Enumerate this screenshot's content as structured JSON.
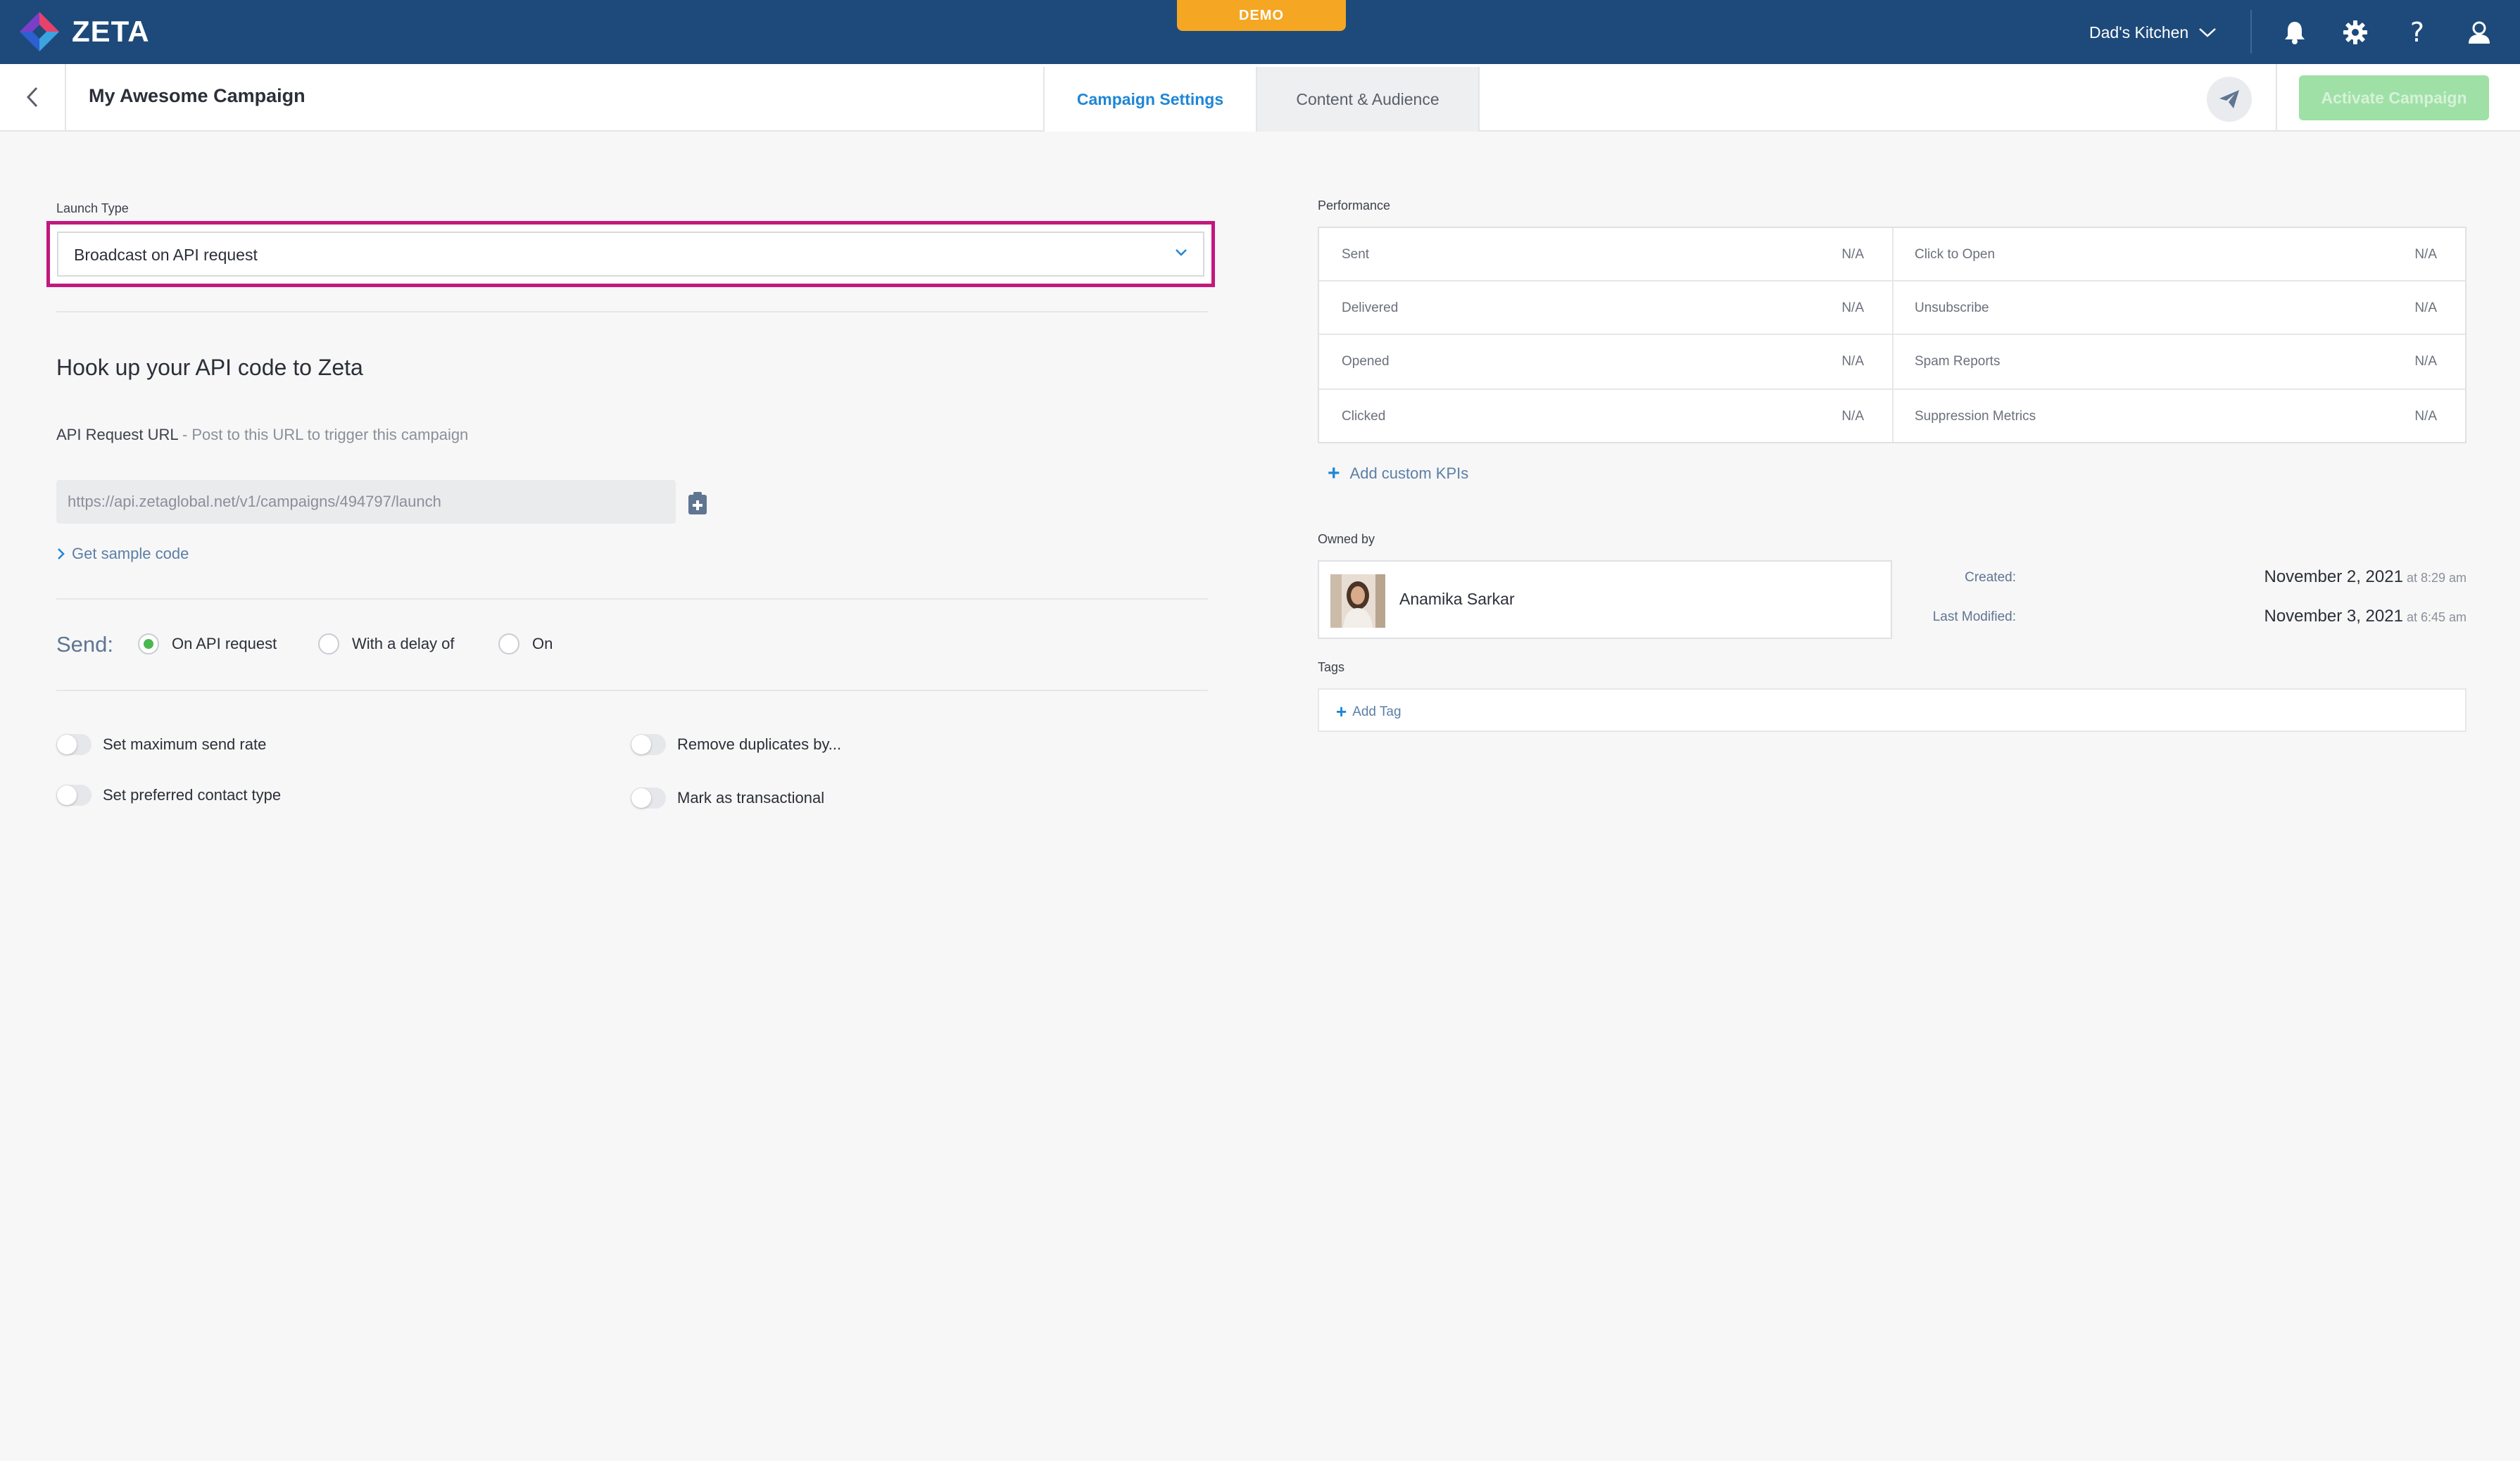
{
  "topbar": {
    "logo_text": "ZETA",
    "demo_badge": "DEMO",
    "account_name": "Dad's Kitchen",
    "icons": [
      "bell-icon",
      "gear-icon",
      "help-icon",
      "user-icon"
    ]
  },
  "header": {
    "campaign_title": "My Awesome Campaign",
    "tabs": [
      {
        "label": "Campaign Settings",
        "active": true
      },
      {
        "label": "Content & Audience",
        "active": false
      }
    ],
    "activate_label": "Activate Campaign"
  },
  "launch": {
    "label": "Launch Type",
    "value": "Broadcast on API request"
  },
  "api": {
    "section_title": "Hook up your API code to Zeta",
    "url_label": "API Request URL",
    "url_hint": " - Post to this URL to trigger this campaign",
    "url_value": "https://api.zetaglobal.net/v1/campaigns/494797/launch",
    "sample_code_label": "Get sample code"
  },
  "send": {
    "label": "Send:",
    "options": [
      {
        "label": "On API request",
        "selected": true
      },
      {
        "label": "With a delay of",
        "selected": false
      },
      {
        "label": "On",
        "selected": false
      }
    ]
  },
  "toggles": [
    {
      "label": "Set maximum send rate",
      "on": false
    },
    {
      "label": "Remove duplicates by...",
      "on": false
    },
    {
      "label": "Set preferred contact type",
      "on": false
    },
    {
      "label": "Mark as transactional",
      "on": false
    }
  ],
  "performance": {
    "label": "Performance",
    "rows": [
      {
        "left_label": "Sent",
        "left_value": "N/A",
        "right_label": "Click to Open",
        "right_value": "N/A"
      },
      {
        "left_label": "Delivered",
        "left_value": "N/A",
        "right_label": "Unsubscribe",
        "right_value": "N/A"
      },
      {
        "left_label": "Opened",
        "left_value": "N/A",
        "right_label": "Spam Reports",
        "right_value": "N/A"
      },
      {
        "left_label": "Clicked",
        "left_value": "N/A",
        "right_label": "Suppression Metrics",
        "right_value": "N/A"
      }
    ],
    "add_kpi_label": "Add custom KPIs"
  },
  "owner": {
    "label": "Owned by",
    "name": "Anamika Sarkar",
    "created_label": "Created:",
    "created_date": "November 2, 2021",
    "created_time": " at 8:29 am",
    "modified_label": "Last Modified:",
    "modified_date": "November 3, 2021",
    "modified_time": " at 6:45 am"
  },
  "tags": {
    "label": "Tags",
    "add_label": "Add Tag"
  },
  "colors": {
    "topbar": "#1d4a7a",
    "demo": "#f5a623",
    "accent": "#1f86d6",
    "highlight": "#c2187e",
    "activate": "#9fe0a6",
    "radio_on": "#4ab84e"
  }
}
